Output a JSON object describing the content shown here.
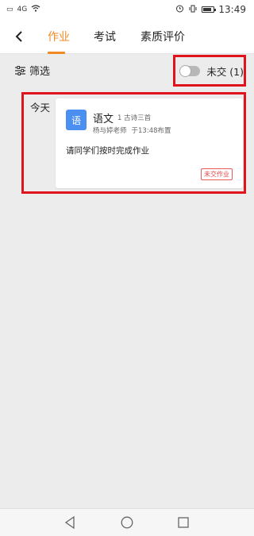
{
  "status_bar": {
    "left_icons": [
      "sim-icon",
      "signal-icon",
      "wifi-icon"
    ],
    "signal_text": "4G",
    "time": "13:49",
    "right_icons": [
      "alarm-icon",
      "vibrate-icon",
      "battery-icon"
    ]
  },
  "nav": {
    "back_icon": "chevron-left-icon",
    "tabs": [
      {
        "label": "作业",
        "active": true
      },
      {
        "label": "考试",
        "active": false
      },
      {
        "label": "素质评价",
        "active": false
      }
    ],
    "accent_color": "#f08a24"
  },
  "toolbar": {
    "filter_label": "筛选",
    "filter_icon": "sliders-icon",
    "toggle_label": "未交 (1)",
    "toggle_on": false
  },
  "homework": {
    "date_label": "今天",
    "items": [
      {
        "subject_icon_text": "语",
        "subject": "语文",
        "count_text": "1 古诗三首",
        "teacher": "杨与婷老师",
        "assigned_time": "于13:48布置",
        "content": "请同学们按时完成作业",
        "status": "未交作业",
        "subject_color": "#4b8ff0"
      }
    ]
  },
  "bottom_nav": {
    "buttons": [
      "back-triangle-icon",
      "home-circle-icon",
      "recents-square-icon"
    ]
  },
  "highlight_color": "#e1141e"
}
